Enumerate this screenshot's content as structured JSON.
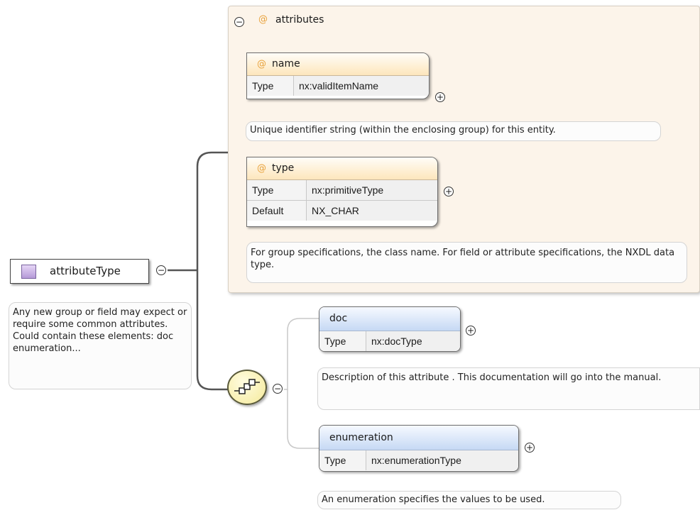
{
  "root": {
    "label": "attributeType",
    "note": "Any new group or field may expect or require some common attributes. Could contain these elements: doc enumeration..."
  },
  "attributes_group": {
    "title": "attributes",
    "items": [
      {
        "name": "name",
        "rows": [
          {
            "key": "Type",
            "value": "nx:validItemName"
          }
        ],
        "note": "Unique identifier string (within the enclosing group) for this entity."
      },
      {
        "name": "type",
        "rows": [
          {
            "key": "Type",
            "value": "nx:primitiveType"
          },
          {
            "key": "Default",
            "value": "NX_CHAR"
          }
        ],
        "note": "For group specifications, the class name. For field or attribute specifications, the NXDL data type."
      }
    ]
  },
  "sequence": {
    "elements": [
      {
        "name": "doc",
        "rows": [
          {
            "key": "Type",
            "value": "nx:docType"
          }
        ],
        "note": "Description of this attribute . This documentation will go into the manual."
      },
      {
        "name": "enumeration",
        "rows": [
          {
            "key": "Type",
            "value": "nx:enumerationType"
          }
        ],
        "note": "An enumeration specifies the values to be used."
      }
    ]
  },
  "icons": {
    "collapse": "−",
    "expand": "+",
    "attribute_marker": "@"
  },
  "colors": {
    "attribute_header": "#fde6bc",
    "element_header": "#c6d9f4",
    "group_background": "#fcf4ea",
    "root_icon": "#b59ad8",
    "compositor": "#f5ea9a"
  }
}
